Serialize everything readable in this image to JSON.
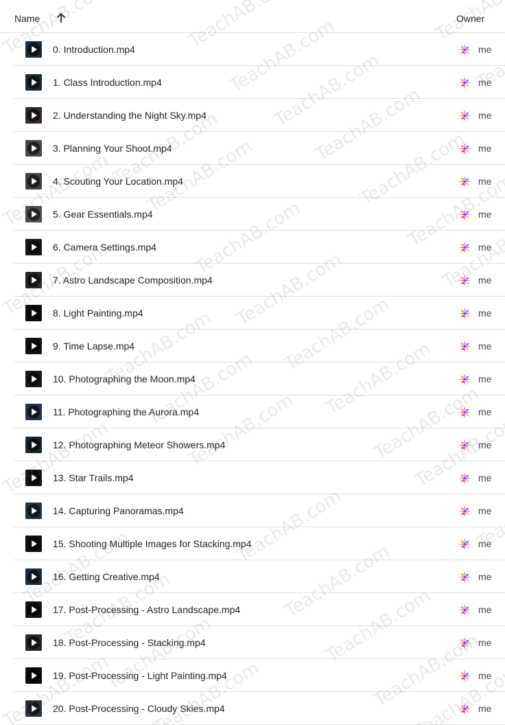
{
  "header": {
    "name_label": "Name",
    "owner_label": "Owner",
    "sort_icon": "arrow-up-icon"
  },
  "watermark_text": "TeachAB.com",
  "files": [
    {
      "name": "0. Introduction.mp4",
      "owner": "me",
      "thumb": "#1f3242"
    },
    {
      "name": "1. Class Introduction.mp4",
      "owner": "me",
      "thumb": "#22303c"
    },
    {
      "name": "2. Understanding the Night Sky.mp4",
      "owner": "me",
      "thumb": "#3a3030"
    },
    {
      "name": "3. Planning Your Shoot.mp4",
      "owner": "me",
      "thumb": "#505050"
    },
    {
      "name": "4. Scouting Your Location.mp4",
      "owner": "me",
      "thumb": "#4a4a4a"
    },
    {
      "name": "5. Gear Essentials.mp4",
      "owner": "me",
      "thumb": "#555555"
    },
    {
      "name": "6. Camera Settings.mp4",
      "owner": "me",
      "thumb": "#1a1a1a"
    },
    {
      "name": "7. Astro Landscape Composition.mp4",
      "owner": "me",
      "thumb": "#2a2a2a"
    },
    {
      "name": "8. Light Painting.mp4",
      "owner": "me",
      "thumb": "#111111"
    },
    {
      "name": "9. Time Lapse.mp4",
      "owner": "me",
      "thumb": "#151515"
    },
    {
      "name": "10. Photographing the Moon.mp4",
      "owner": "me",
      "thumb": "#1c1c1c"
    },
    {
      "name": "11. Photographing the Aurora.mp4",
      "owner": "me",
      "thumb": "#2a3a55"
    },
    {
      "name": "12. Photographing Meteor Showers.mp4",
      "owner": "me",
      "thumb": "#1e2a38"
    },
    {
      "name": "13. Star Trails.mp4",
      "owner": "me",
      "thumb": "#141414"
    },
    {
      "name": "14. Capturing Panoramas.mp4",
      "owner": "me",
      "thumb": "#283848"
    },
    {
      "name": "15. Shooting Multiple Images for Stacking.mp4",
      "owner": "me",
      "thumb": "#121212"
    },
    {
      "name": "16. Getting Creative.mp4",
      "owner": "me",
      "thumb": "#203040"
    },
    {
      "name": "17. Post-Processing - Astro Landscape.mp4",
      "owner": "me",
      "thumb": "#181818"
    },
    {
      "name": "18. Post-Processing - Stacking.mp4",
      "owner": "me",
      "thumb": "#2c2c2c"
    },
    {
      "name": "19. Post-Processing - Light Painting.mp4",
      "owner": "me",
      "thumb": "#101010"
    },
    {
      "name": "20. Post-Processing - Cloudy Skies.mp4",
      "owner": "me",
      "thumb": "#303840"
    }
  ]
}
